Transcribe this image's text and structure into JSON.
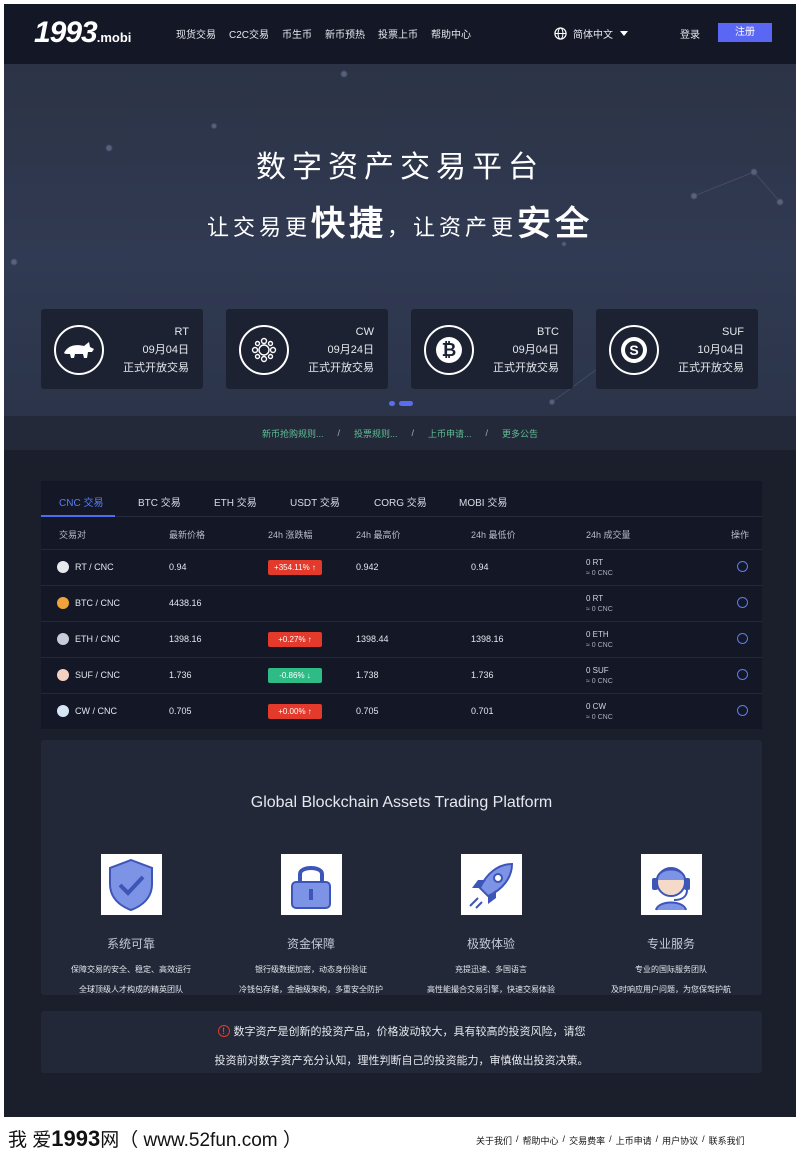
{
  "header": {
    "logo_big": "1993",
    "logo_small": ".mobi",
    "nav": [
      "现货交易",
      "C2C交易",
      "币生币",
      "新币预热",
      "投票上币",
      "帮助中心"
    ],
    "language": "简体中文",
    "login": "登录",
    "register": "注册"
  },
  "hero": {
    "title": "数字资产交易平台",
    "sub_part1": "让交易更",
    "sub_em1": "快捷",
    "sub_part2": "，让资产更",
    "sub_em2": "安全",
    "cards": [
      {
        "symbol": "RT",
        "date": "09月04日",
        "status": "正式开放交易",
        "icon": "rhino-icon"
      },
      {
        "symbol": "CW",
        "date": "09月24日",
        "status": "正式开放交易",
        "icon": "cw-coin-icon"
      },
      {
        "symbol": "BTC",
        "date": "09月04日",
        "status": "正式开放交易",
        "icon": "bitcoin-icon"
      },
      {
        "symbol": "SUF",
        "date": "10月04日",
        "status": "正式开放交易",
        "icon": "suf-coin-icon"
      }
    ]
  },
  "notice": {
    "items": [
      "新币抢购规则...",
      "投票规则...",
      "上币申请...",
      "更多公告"
    ],
    "separator": "/"
  },
  "market": {
    "tabs": [
      "CNC 交易",
      "BTC 交易",
      "ETH 交易",
      "USDT 交易",
      "CORG 交易",
      "MOBI 交易"
    ],
    "headers": [
      "交易对",
      "最新价格",
      "24h 涨跌幅",
      "24h 最高价",
      "24h 最低价",
      "24h 成交量",
      "操作"
    ],
    "rows": [
      {
        "pair": "RT / CNC",
        "price": "0.94",
        "change": "+354.11% ↑",
        "dir": "up",
        "high": "0.942",
        "low": "0.94",
        "vol": "0 RT",
        "vol_cnc": "≈ 0 CNC"
      },
      {
        "pair": "BTC / CNC",
        "price": "4438.16",
        "change": "",
        "dir": "",
        "high": "",
        "low": "",
        "vol": "0 RT",
        "vol_cnc": "≈ 0 CNC"
      },
      {
        "pair": "ETH / CNC",
        "price": "1398.16",
        "change": "+0.27% ↑",
        "dir": "up",
        "high": "1398.44",
        "low": "1398.16",
        "vol": "0 ETH",
        "vol_cnc": "≈ 0 CNC"
      },
      {
        "pair": "SUF / CNC",
        "price": "1.736",
        "change": "-0.86% ↓",
        "dir": "down",
        "high": "1.738",
        "low": "1.736",
        "vol": "0 SUF",
        "vol_cnc": "≈ 0 CNC"
      },
      {
        "pair": "CW / CNC",
        "price": "0.705",
        "change": "+0.00% ↑",
        "dir": "up",
        "high": "0.705",
        "low": "0.701",
        "vol": "0 CW",
        "vol_cnc": "≈ 0 CNC"
      }
    ]
  },
  "features": {
    "title": "Global Blockchain Assets Trading Platform",
    "items": [
      {
        "name": "系统可靠",
        "d1": "保障交易的安全、稳定、高效运行",
        "d2": "全球顶级人才构成的精英团队",
        "icon": "shield-check-icon"
      },
      {
        "name": "资金保障",
        "d1": "银行级数据加密，动态身份验证",
        "d2": "冷钱包存储，金融级架构，多重安全防护",
        "icon": "padlock-icon"
      },
      {
        "name": "极致体验",
        "d1": "充提迅速、多国语言",
        "d2": "高性能撮合交易引擎，快速交易体验",
        "icon": "rocket-icon"
      },
      {
        "name": "专业服务",
        "d1": "专业的国际服务团队",
        "d2": "及时响应用户问题，为您保驾护航",
        "icon": "headset-support-icon"
      }
    ]
  },
  "risk": {
    "line1": "数字资产是创新的投资产品，价格波动较大，具有较高的投资风险，请您",
    "line2": "投资前对数字资产充分认知，理性判断自己的投资能力，审慎做出投资决策。"
  },
  "footer": {
    "water_pre": "我 爱",
    "water_big": "1993",
    "water_post": "网（ www.52fun.com ）",
    "links": [
      "关于我们",
      "帮助中心",
      "交易费率",
      "上币申请",
      "用户协议",
      "联系我们"
    ]
  },
  "colors": {
    "accent": "#5a67f5",
    "up": "#e43a2b",
    "down": "#2fbb86",
    "notice": "#5fbf95"
  }
}
